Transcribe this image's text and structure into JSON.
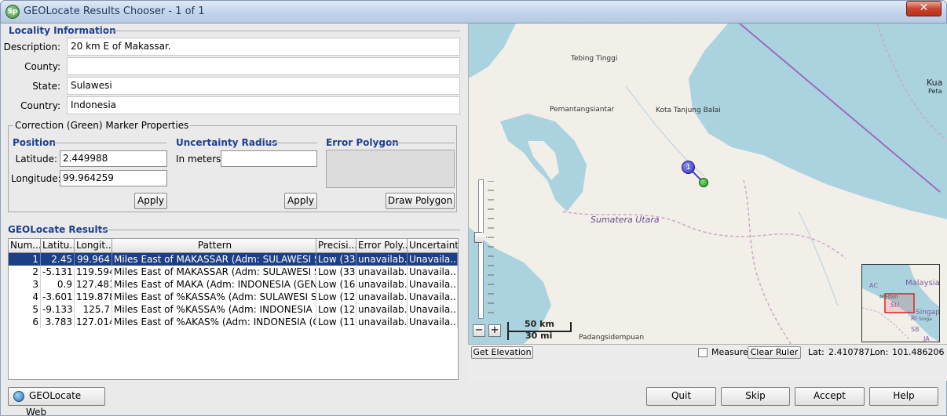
{
  "window": {
    "title": "GEOLocate Results Chooser - 1 of 1",
    "close_glyph": "✕",
    "app_icon_text": "Sp"
  },
  "locality": {
    "section_title": "Locality Information",
    "fields": [
      {
        "label": "Description:",
        "value": "20 km E of Makassar."
      },
      {
        "label": "County:",
        "value": ""
      },
      {
        "label": "State:",
        "value": "Sulawesi"
      },
      {
        "label": "Country:",
        "value": "Indonesia"
      }
    ]
  },
  "correction": {
    "group_title": "Correction (Green) Marker Properties",
    "position": {
      "title": "Position",
      "latitude_label": "Latitude:",
      "latitude": "2.449988",
      "longitude_label": "Longitude:",
      "longitude": "99.964259",
      "apply": "Apply"
    },
    "uncertainty": {
      "title": "Uncertainty Radius",
      "meters_label": "In meters:",
      "meters_value": "",
      "apply": "Apply"
    },
    "polygon": {
      "title": "Error Polygon",
      "draw": "Draw Polygon"
    }
  },
  "results": {
    "section_title": "GEOLocate Results",
    "columns": [
      "Num...",
      "Latitu...",
      "Longit...",
      "Pattern",
      "Precisi...",
      "Error Poly...",
      "Uncertainty"
    ],
    "rows": [
      {
        "num": "1",
        "lat": "2.45",
        "lon": "99.964",
        "pattern": "Miles East of MAKASSAR (Adm: SULAWESI S...",
        "precision": "Low (33)",
        "error_poly": "unavailab...",
        "uncertainty": "Unavaila...",
        "selected": true
      },
      {
        "num": "2",
        "lat": "-5.131",
        "lon": "119.594",
        "pattern": "Miles East of MAKASSAR (Adm: SULAWESI S...",
        "precision": "Low (33)",
        "error_poly": "unavailab...",
        "uncertainty": "Unavaila...",
        "selected": false
      },
      {
        "num": "3",
        "lat": "0.9",
        "lon": "127.481",
        "pattern": "Miles East of MAKA (Adm: INDONESIA (GENE...",
        "precision": "Low (16)",
        "error_poly": "unavailab...",
        "uncertainty": "Unavaila...",
        "selected": false
      },
      {
        "num": "4",
        "lat": "-3.601",
        "lon": "119.878",
        "pattern": "Miles East of %KASSA% (Adm: SULAWESI S...",
        "precision": "Low (12)",
        "error_poly": "unavailab...",
        "uncertainty": "Unavaila...",
        "selected": false
      },
      {
        "num": "5",
        "lat": "-9.133",
        "lon": "125.7",
        "pattern": "Miles East of %KASSA% (Adm: INDONESIA (...",
        "precision": "Low (12)",
        "error_poly": "unavailab...",
        "uncertainty": "Unavaila...",
        "selected": false
      },
      {
        "num": "6",
        "lat": "3.783",
        "lon": "127.014",
        "pattern": "Miles East of %AKAS% (Adm: INDONESIA (G...",
        "precision": "Low (11)",
        "error_poly": "unavailab...",
        "uncertainty": "Unavaila...",
        "selected": false
      }
    ]
  },
  "map": {
    "places": [
      "Tebing Tinggi",
      "Pemantangsiantar",
      "Kota Tanjung Balai",
      "Sumatera Utara",
      "Padangsidempuan",
      "Kua",
      "Peta"
    ],
    "marker_label": "1",
    "scale_km": "50 km",
    "scale_mi": "30 mi",
    "zoom_out": "−",
    "zoom_in": "+",
    "overview_labels": [
      "Malaysia",
      "AC",
      "Medan",
      "SU",
      "Singap",
      "Singa",
      "RI",
      "SB",
      "JA"
    ],
    "colors": {
      "water": "#aad3df",
      "land": "#f2efe9",
      "correction_marker": "#21a81c",
      "result_marker": "#3b3bd6",
      "boundary": "#8c5aa8"
    }
  },
  "map_toolbar": {
    "get_elevation": "Get Elevation",
    "measure_label": "Measure",
    "clear_ruler": "Clear Ruler",
    "lat_label": "Lat:",
    "lat_value": "2.410787,",
    "lon_label": "Lon:",
    "lon_value": "101.486206"
  },
  "footer": {
    "web_button": "GEOLocate Web",
    "quit": "Quit",
    "skip": "Skip",
    "accept": "Accept",
    "help": "Help"
  }
}
